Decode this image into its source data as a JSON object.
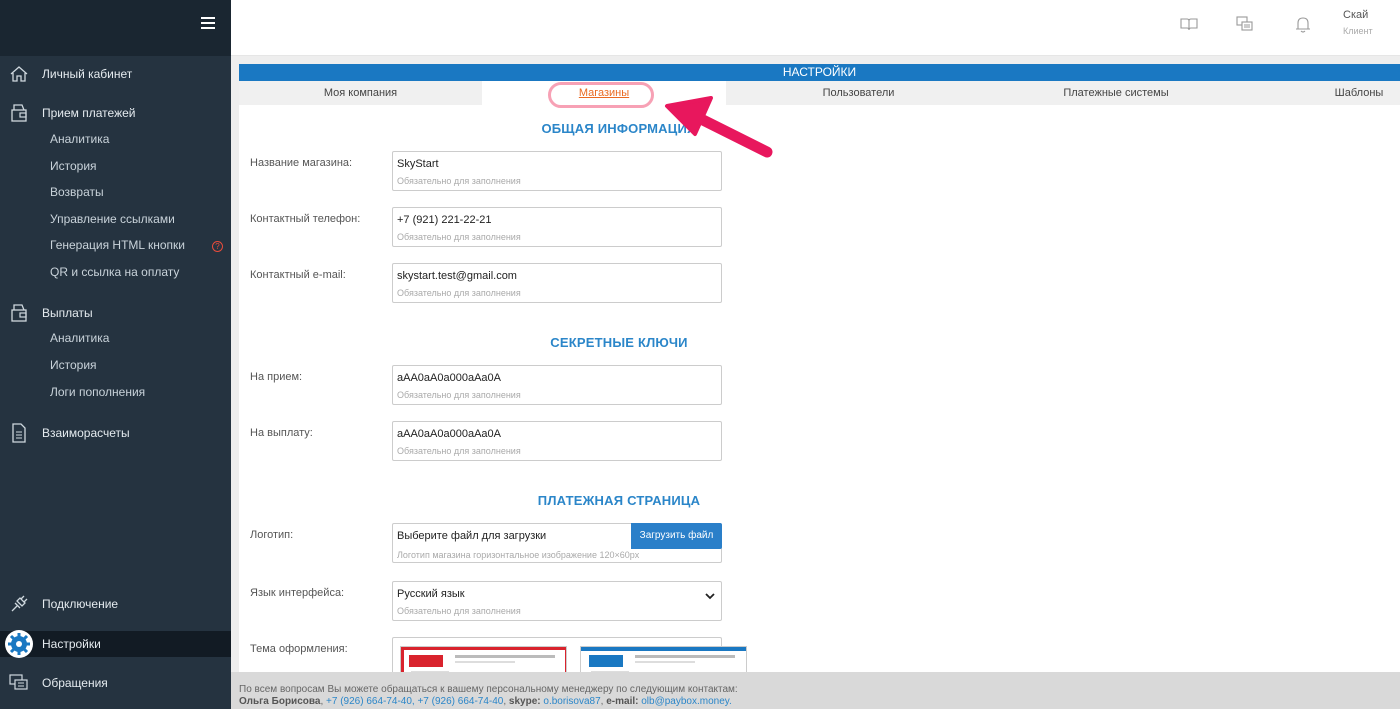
{
  "sidebar": {
    "items": [
      {
        "label": "Личный кабинет",
        "icon": "home-icon"
      },
      {
        "label": "Прием платежей",
        "icon": "wallet-icon"
      },
      {
        "label": "Выплаты",
        "icon": "wallet-icon"
      },
      {
        "label": "Взаиморасчеты",
        "icon": "document-icon"
      },
      {
        "label": "Подключение",
        "icon": "plug-icon"
      },
      {
        "label": "Настройки",
        "icon": "gear-icon"
      },
      {
        "label": "Обращения",
        "icon": "chat-icon"
      }
    ],
    "payments_sub": [
      "Аналитика",
      "История",
      "Возвраты",
      "Управление ссылками",
      "Генерация HTML кнопки",
      "QR и ссылка на оплату"
    ],
    "payouts_sub": [
      "Аналитика",
      "История",
      "Логи пополнения"
    ],
    "badge": "?"
  },
  "topbar": {
    "user_name": "Скай",
    "user_role": "Клиент",
    "icons": [
      "book-icon",
      "chat-icon",
      "bell-icon"
    ]
  },
  "panel": {
    "header": "НАСТРОЙКИ",
    "tabs": [
      "Моя компания",
      "Магазины",
      "Пользователи",
      "Платежные системы",
      "Шаблоны"
    ],
    "active_tab": "Магазины"
  },
  "sections": {
    "general": "ОБЩАЯ ИНФОРМАЦИЯ",
    "keys": "СЕКРЕТНЫЕ КЛЮЧИ",
    "payment_page": "ПЛАТЕЖНАЯ СТРАНИЦА"
  },
  "fields": {
    "shop_name": {
      "label": "Название магазина:",
      "value": "SkyStart",
      "hint": "Обязательно для заполнения"
    },
    "phone": {
      "label": "Контактный телефон:",
      "value": "+7 (921) 221-22-21",
      "hint": "Обязательно для заполнения"
    },
    "email": {
      "label": "Контактный e-mail:",
      "value": "skystart.test@gmail.com",
      "hint": "Обязательно для заполнения"
    },
    "key_in": {
      "label": "На прием:",
      "value": "aAA0aA0a000aAa0A",
      "hint": "Обязательно для заполнения"
    },
    "key_out": {
      "label": "На выплату:",
      "value": "aAA0aA0a000aAa0A",
      "hint": "Обязательно для заполнения"
    },
    "logo": {
      "label": "Логотип:",
      "value": "Выберите файл для загрузки",
      "button": "Загрузить файл",
      "hint": "Логотип магазина горизонтальное изображение 120×60px"
    },
    "language": {
      "label": "Язык интерфейса:",
      "value": "Русский язык",
      "hint": "Обязательно для заполнения"
    },
    "theme": {
      "label": "Тема оформления:"
    }
  },
  "colors": {
    "sidebar_bg": "#253340",
    "header_blue": "#1a78c2",
    "active_tab": "#ea6a21",
    "arrow": "#e8175d",
    "theme_red": "#d9232d",
    "theme_blue": "#1a78c2"
  },
  "footer": {
    "line1": "По всем вопросам Вы можете обращаться к вашему персональному менеджеру по следующим контактам:",
    "manager": "Ольга Борисова",
    "phones": "+7 (926) 664-74-40, +7 (926) 664-74-40",
    "skype_label": "skype:",
    "skype": "o.borisova87",
    "email_label": "e-mail:",
    "email": "olb@paybox.money."
  }
}
